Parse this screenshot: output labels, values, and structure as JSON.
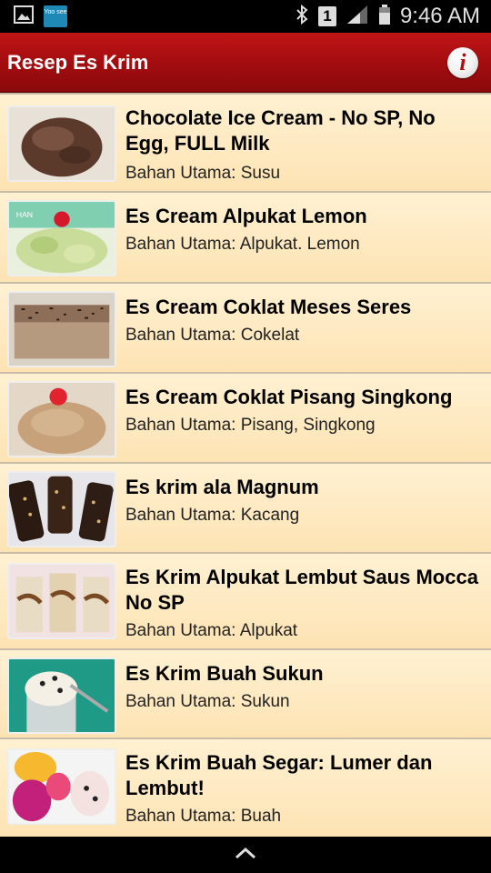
{
  "status": {
    "time": "9:46 AM",
    "sim_slot": "1",
    "notif_app": "Yoo see"
  },
  "app_bar": {
    "title": "Resep Es Krim",
    "info_glyph": "i"
  },
  "recipes": [
    {
      "title": "Chocolate Ice Cream - No SP, No Egg, FULL Milk",
      "subtitle": "Bahan Utama: Susu"
    },
    {
      "title": "Es Cream Alpukat Lemon",
      "subtitle": "Bahan Utama: Alpukat. Lemon",
      "thumb_text": "HAN"
    },
    {
      "title": "Es Cream Coklat Meses Seres",
      "subtitle": "Bahan Utama: Cokelat"
    },
    {
      "title": "Es Cream Coklat Pisang Singkong",
      "subtitle": "Bahan Utama: Pisang, Singkong"
    },
    {
      "title": "Es krim ala Magnum",
      "subtitle": "Bahan Utama: Kacang"
    },
    {
      "title": "Es Krim Alpukat Lembut Saus Mocca No SP",
      "subtitle": "Bahan Utama: Alpukat"
    },
    {
      "title": "Es Krim Buah Sukun",
      "subtitle": "Bahan Utama: Sukun"
    },
    {
      "title": "Es Krim Buah Segar: Lumer dan Lembut!",
      "subtitle": "Bahan Utama: Buah"
    }
  ],
  "colors": {
    "app_bar": "#a10c0f",
    "list_bg": "#fde3b3",
    "divider": "#c9bca6"
  },
  "icons": {
    "status_left": [
      "gallery-icon",
      "yoosee-app-icon"
    ],
    "status_right": [
      "bluetooth-icon",
      "sim-1-icon",
      "signal-icon",
      "battery-icon"
    ],
    "nav": "chevron-up-icon"
  }
}
